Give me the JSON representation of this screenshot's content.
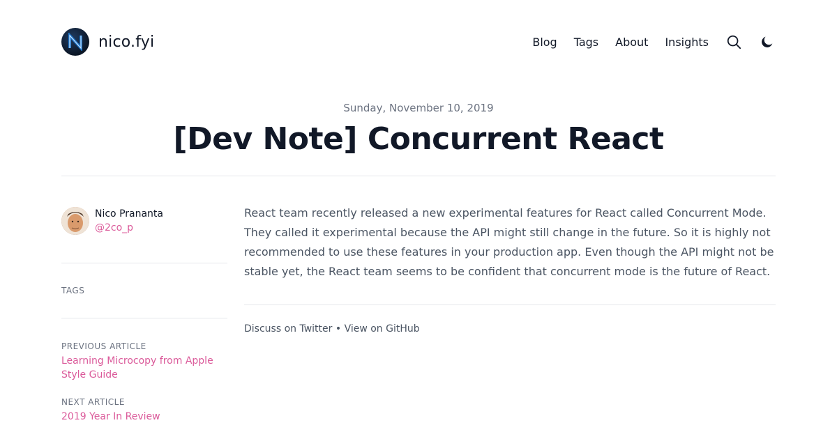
{
  "header": {
    "site_name": "nico.fyi",
    "nav": [
      "Blog",
      "Tags",
      "About",
      "Insights"
    ]
  },
  "post": {
    "date": "Sunday, November 10, 2019",
    "title": "[Dev Note] Concurrent React",
    "body": "React team recently released a new experimental features for React called Concurrent Mode. They called it experimental because the API might still change in the future. So it is highly not recommended to use these features in your production app. Even though the API might not be stable yet, the React team seems to be confident that concurrent mode is the future of React."
  },
  "author": {
    "name": "Nico Prananta",
    "handle": "@2co_p"
  },
  "sidebar": {
    "tags_label": "TAGS",
    "previous_label": "PREVIOUS ARTICLE",
    "previous_title": "Learning Microcopy from Apple Style Guide",
    "next_label": "NEXT ARTICLE",
    "next_title": "2019 Year In Review"
  },
  "footer_links": {
    "discuss": "Discuss on Twitter",
    "separator": " • ",
    "github": "View on GitHub"
  },
  "colors": {
    "accent": "#db5a9a",
    "text": "#111827",
    "muted": "#6b7280"
  },
  "icons": [
    "logo-icon",
    "search-icon",
    "moon-icon"
  ]
}
